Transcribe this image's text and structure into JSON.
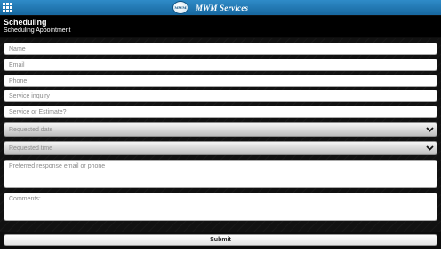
{
  "topbar": {
    "menu_icon": "grid-menu-icon",
    "logo_text": "MWM",
    "brand_name": "MWM Services",
    "color": "#1f7ab8"
  },
  "page": {
    "title": "Scheduling",
    "subtitle": "Scheduling Appointment"
  },
  "form": {
    "name_placeholder": "Name",
    "email_placeholder": "Email",
    "phone_placeholder": "Phone",
    "service_inquiry_placeholder": "Service inquiry",
    "service_or_estimate_placeholder": "Service or Estimate?",
    "requested_date": "Requested date",
    "requested_time": "Requested time",
    "preferred_response_placeholder": "Preferred response email or phone",
    "comments_placeholder": "Comments:",
    "dropdown_icon": "chevron-down-icon"
  },
  "footer": {
    "submit_label": "Submit"
  }
}
